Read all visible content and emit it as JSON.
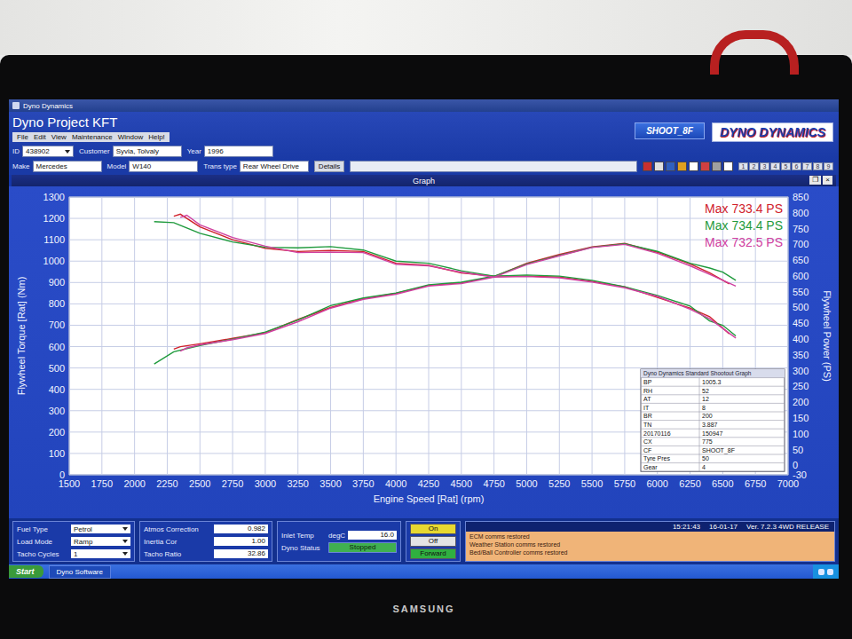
{
  "monitor": {
    "brand": "SAMSUNG"
  },
  "window": {
    "title": "Dyno Dynamics"
  },
  "app": {
    "title": "Dyno Project KFT",
    "menu": [
      "File",
      "Edit",
      "View",
      "Maintenance",
      "Window",
      "Help!"
    ],
    "shootout_button": "SHOOT_8F",
    "logo": "DYNO DYNAMICS"
  },
  "field_rows": [
    [
      {
        "label": "ID",
        "value": "438902",
        "kind": "dropdown"
      },
      {
        "label": "Customer",
        "value": "Syvia, Tolvaly",
        "kind": "text"
      },
      {
        "label": "Year",
        "value": "1996",
        "kind": "text"
      }
    ],
    [
      {
        "label": "Make",
        "value": "Mercedes",
        "kind": "text"
      },
      {
        "label": "Model",
        "value": "W140",
        "kind": "text"
      },
      {
        "label": "Trans type",
        "value": "Rear Wheel Drive",
        "kind": "text"
      }
    ]
  ],
  "details_button": "Details",
  "number_buttons": [
    "1",
    "2",
    "3",
    "4",
    "5",
    "6",
    "7",
    "8",
    "9"
  ],
  "graph": {
    "title": "Graph",
    "window_controls": [
      "❐",
      "×"
    ],
    "y_left": {
      "label": "Flywheel Torque [Rat] (Nm)",
      "ticks": [
        "0",
        "100",
        "200",
        "300",
        "400",
        "500",
        "600",
        "700",
        "800",
        "900",
        "1000",
        "1100",
        "1200",
        "1300"
      ]
    },
    "y_right": {
      "label": "Flywheel Power (PS)",
      "ticks": [
        "-30",
        "0",
        "50",
        "100",
        "150",
        "200",
        "250",
        "300",
        "350",
        "400",
        "450",
        "500",
        "550",
        "600",
        "650",
        "700",
        "750",
        "800",
        "850"
      ]
    },
    "x_axis": {
      "label": "Engine Speed [Rat] (rpm)",
      "ticks": [
        "1500",
        "1750",
        "2000",
        "2250",
        "2500",
        "2750",
        "3000",
        "3250",
        "3500",
        "3750",
        "4000",
        "4250",
        "4500",
        "4750",
        "5000",
        "5250",
        "5500",
        "5750",
        "6000",
        "6250",
        "6500",
        "6750",
        "7000"
      ]
    },
    "series": [
      {
        "legend": "Max 733.4 PS",
        "color": "#d0202a",
        "rpm": [
          2300,
          2350,
          2500,
          2750,
          3000,
          3250,
          3500,
          3750,
          4000,
          4250,
          4500,
          4750,
          5000,
          5250,
          5500,
          5750,
          6000,
          6250,
          6400,
          6550
        ],
        "torque_nm": [
          1210,
          1220,
          1160,
          1100,
          1060,
          1045,
          1050,
          1045,
          990,
          980,
          945,
          930,
          930,
          925,
          905,
          880,
          830,
          780,
          740,
          660
        ],
        "power_ps": [
          368,
          376,
          385,
          402,
          420,
          462,
          500,
          528,
          545,
          570,
          578,
          598,
          640,
          668,
          692,
          703,
          675,
          638,
          610,
          575
        ]
      },
      {
        "legend": "Max 734.4 PS",
        "color": "#1f9a3c",
        "rpm": [
          2150,
          2300,
          2500,
          2750,
          3000,
          3250,
          3500,
          3750,
          4000,
          4250,
          4500,
          4750,
          5000,
          5250,
          5500,
          5750,
          6000,
          6250,
          6400,
          6500,
          6600
        ],
        "torque_nm": [
          1185,
          1180,
          1130,
          1090,
          1065,
          1062,
          1068,
          1052,
          1000,
          990,
          955,
          930,
          935,
          930,
          910,
          880,
          840,
          790,
          720,
          700,
          650
        ],
        "power_ps": [
          321,
          360,
          380,
          400,
          422,
          460,
          506,
          530,
          546,
          572,
          580,
          599,
          638,
          665,
          691,
          702,
          678,
          640,
          625,
          612,
          586
        ]
      },
      {
        "legend": "Max 732.5 PS",
        "color": "#d040a0",
        "rpm": [
          2350,
          2400,
          2500,
          2750,
          3000,
          3250,
          3500,
          3750,
          4000,
          4250,
          4500,
          4750,
          5000,
          5250,
          5500,
          5750,
          6000,
          6250,
          6400,
          6600
        ],
        "torque_nm": [
          1205,
          1215,
          1170,
          1110,
          1070,
          1040,
          1042,
          1040,
          985,
          978,
          948,
          925,
          928,
          922,
          902,
          875,
          835,
          775,
          730,
          640
        ],
        "power_ps": [
          362,
          372,
          382,
          398,
          418,
          455,
          498,
          526,
          542,
          568,
          576,
          596,
          636,
          664,
          690,
          700,
          672,
          632,
          605,
          568
        ]
      }
    ],
    "info_table": {
      "title": "Dyno Dynamics Standard Shootout Graph",
      "rows": [
        {
          "key": "BP",
          "value": "1005.3"
        },
        {
          "key": "RH",
          "value": "52"
        },
        {
          "key": "AT",
          "value": "12"
        },
        {
          "key": "IT",
          "value": "8"
        },
        {
          "key": "BR",
          "value": "200"
        },
        {
          "key": "TN",
          "value": "3.887"
        },
        {
          "key": "20170116",
          "value": "150947"
        },
        {
          "key": "CX",
          "value": "775"
        },
        {
          "key": "CF",
          "value": "SHOOT_8F"
        },
        {
          "key": "Tyre Pres",
          "value": "50"
        },
        {
          "key": "Gear",
          "value": "4"
        }
      ]
    }
  },
  "controls": {
    "settings": [
      {
        "label": "Fuel Type",
        "value": "Petrol"
      },
      {
        "label": "Load Mode",
        "value": "Ramp"
      },
      {
        "label": "Tacho Cycles",
        "value": "1"
      }
    ],
    "corrections": [
      {
        "label": "Atmos Correction",
        "value": "0.982"
      },
      {
        "label": "Inertia Cor",
        "value": "1.00"
      },
      {
        "label": "Tacho Ratio",
        "value": "32.86"
      }
    ],
    "readings": [
      {
        "label": "Inlet Temp",
        "unit": "degC",
        "value": "16.0"
      },
      {
        "label": "Dyno Status",
        "unit": "",
        "value": "Stopped"
      }
    ],
    "switches": [
      {
        "label": "On",
        "color": "#e8d830"
      },
      {
        "label": "Off",
        "color": "#e4e4e4"
      },
      {
        "label": "Forward",
        "color": "#30b040"
      }
    ]
  },
  "status": {
    "time": "15:21:43",
    "date": "16-01-17",
    "version": "Ver. 7.2.3 4WD RELEASE",
    "messages": [
      "ECM comms restored",
      "Weather Station comms restored",
      "Bed/Ball Controller comms restored"
    ]
  },
  "taskbar": {
    "start": "Start",
    "items": [
      "Dyno Software"
    ]
  }
}
